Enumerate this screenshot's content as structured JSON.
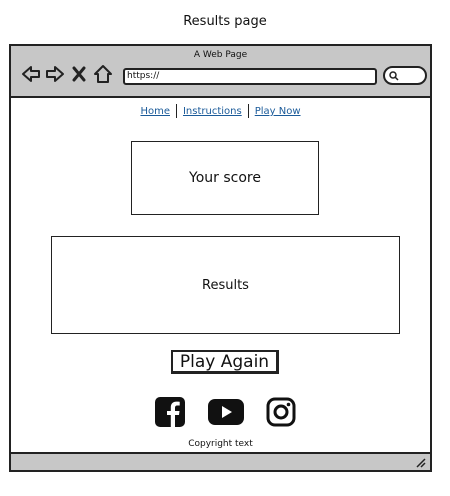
{
  "page_caption": "Results page",
  "browser": {
    "title": "A Web Page",
    "url": "https://",
    "icons": [
      "back-arrow-icon",
      "forward-arrow-icon",
      "close-x-icon",
      "home-icon",
      "search-icon",
      "resize-grip-icon"
    ]
  },
  "nav": {
    "links": [
      "Home",
      "Instructions",
      "Play Now"
    ]
  },
  "main": {
    "score_label": "Your score",
    "results_label": "Results",
    "play_again_label": "Play Again"
  },
  "social": {
    "icons": [
      "facebook-icon",
      "youtube-icon",
      "instagram-icon"
    ]
  },
  "footer": {
    "copyright": "Copyright text"
  }
}
